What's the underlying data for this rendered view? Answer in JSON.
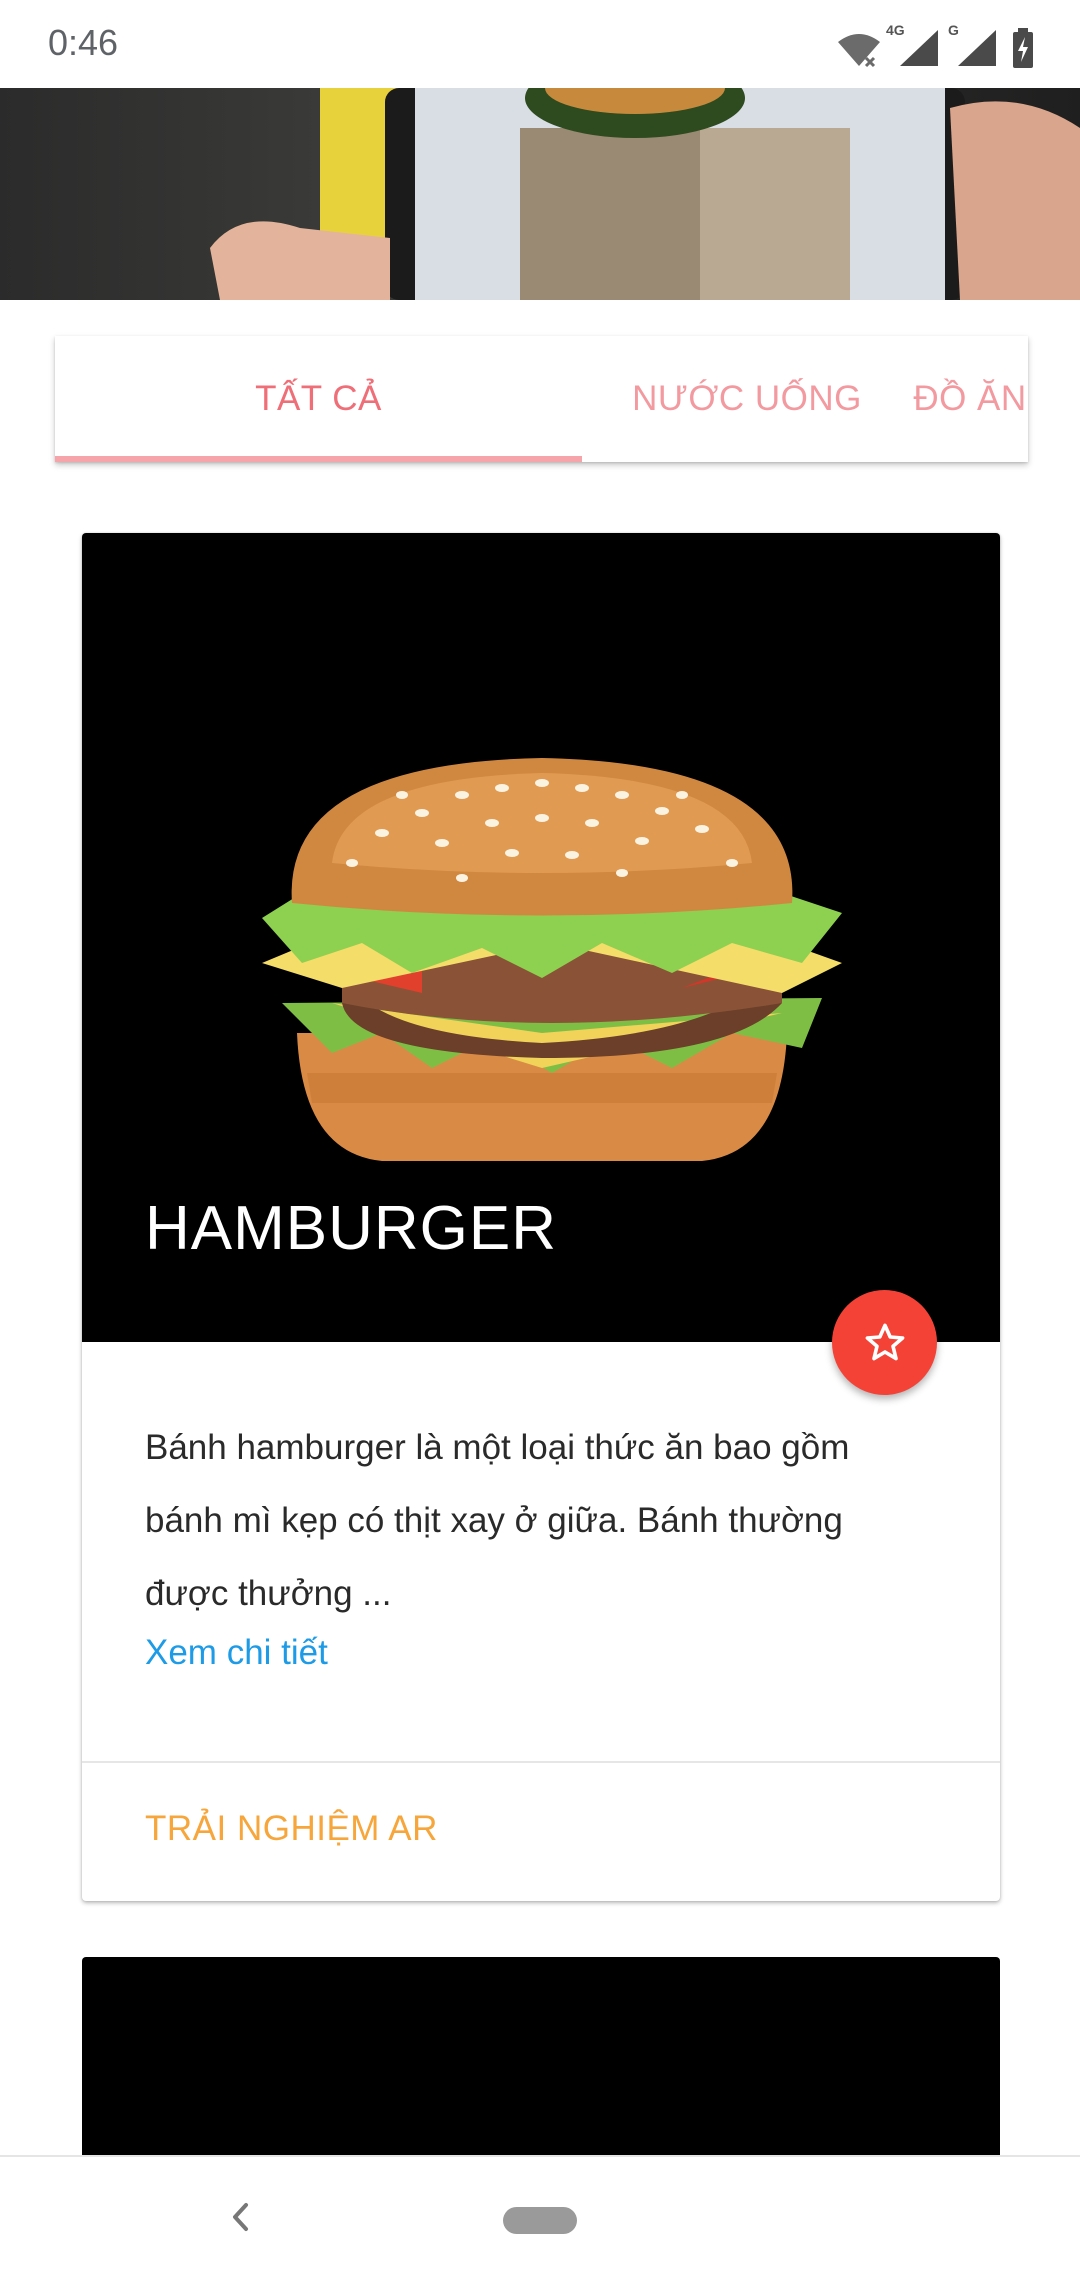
{
  "status_bar": {
    "time": "0:46",
    "network_1": "4G",
    "network_2": "G",
    "icons": [
      "wifi-icon",
      "signal-icon",
      "signal-icon",
      "battery-charging-icon"
    ]
  },
  "tabs": [
    {
      "label": "TẤT CẢ",
      "selected": true
    },
    {
      "label": "NƯỚC UỐNG",
      "selected": false
    },
    {
      "label": "ĐỒ ĂN",
      "selected": false
    }
  ],
  "card": {
    "title": "HAMBURGER",
    "description": "Bánh hamburger là một loại thức ăn bao gồm bánh mì kẹp có thịt xay ở giữa. Bánh thường được thưởng ...",
    "more_link": "Xem chi tiết",
    "action": "TRẢI NGHIỆM AR",
    "fab_icon": "star-outline-icon"
  },
  "colors": {
    "tab_accent": "#ef6f78",
    "link": "#1e9be6",
    "action": "#f6a63b",
    "fab": "#f44336"
  },
  "nav_bar": {
    "icons": [
      "back-icon",
      "home-pill-icon"
    ]
  }
}
